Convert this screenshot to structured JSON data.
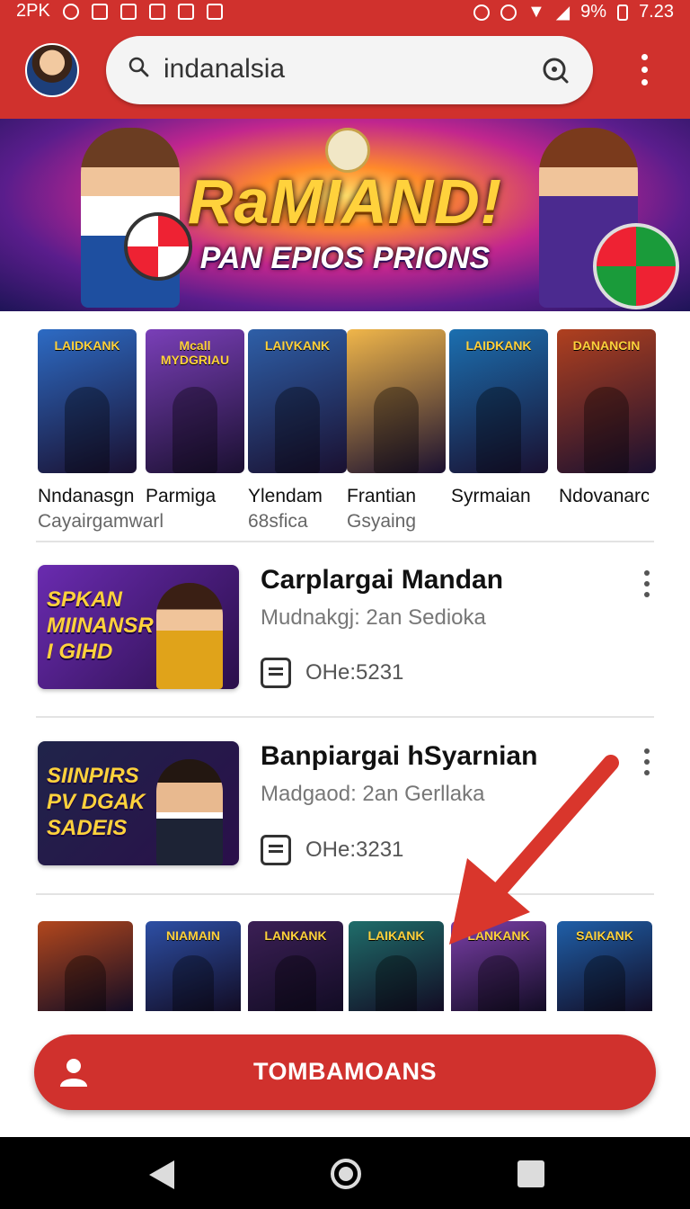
{
  "status_bar": {
    "carrier": "2PK",
    "battery": "9%",
    "time": "7.23"
  },
  "app_bar": {
    "search_query": "indanalsia"
  },
  "banner": {
    "title": "RaMIAND!",
    "subtitle": "PAN EPIOS PRIONS"
  },
  "tiles": [
    {
      "art_title": "LAIDKANK",
      "name": "Nndanasgn",
      "sub": "Cayairgamwarl",
      "bg": "#2d6bc4"
    },
    {
      "art_title": "Mcall MYDGRIAU",
      "name": "Parmiga",
      "sub": "",
      "bg": "#7a3fb8"
    },
    {
      "art_title": "LAIVKANK",
      "name": "Ylendam",
      "sub": "68sfica",
      "bg": "#2e5fa8"
    },
    {
      "art_title": "",
      "name": "Frantian",
      "sub": "Gsyaing",
      "bg": "#f0b64a"
    },
    {
      "art_title": "LAIDKANK",
      "name": "Syrmaian",
      "sub": "",
      "bg": "#1b6fb0"
    },
    {
      "art_title": "DANANCIN",
      "name": "Ndovanarc",
      "sub": "",
      "bg": "#b0401f"
    }
  ],
  "list_items": [
    {
      "thumb_title": "SPKAN\nMIINANSR\nI GIHD",
      "title": "Carplargai Mandan",
      "subtitle": "Mudnakgj: 2an Sedioka",
      "meta": "OHe:5231",
      "bg": "#6a2bb0"
    },
    {
      "thumb_title": "SIINPIRS\nPV DGAK\nSADEIS",
      "title": "Banpiargai hSyarnian",
      "subtitle": "Madgaod: 2an Gerllaka",
      "meta": "OHe:3231",
      "bg": "#20244a"
    }
  ],
  "bottom_tiles": [
    {
      "art_title": "",
      "bg": "#b2471d"
    },
    {
      "art_title": "NIAMAIN",
      "bg": "#2d4fa5"
    },
    {
      "art_title": "LANKANK",
      "bg": "#3b1f55"
    },
    {
      "art_title": "LAIKANK",
      "bg": "#1f6d6a"
    },
    {
      "art_title": "LANKANK",
      "bg": "#7b3fa8"
    },
    {
      "art_title": "SAIKANK",
      "bg": "#1f5fa8"
    }
  ],
  "cta": {
    "label": "TOMBAMOANS"
  },
  "colors": {
    "brand_red": "#d0312d"
  }
}
